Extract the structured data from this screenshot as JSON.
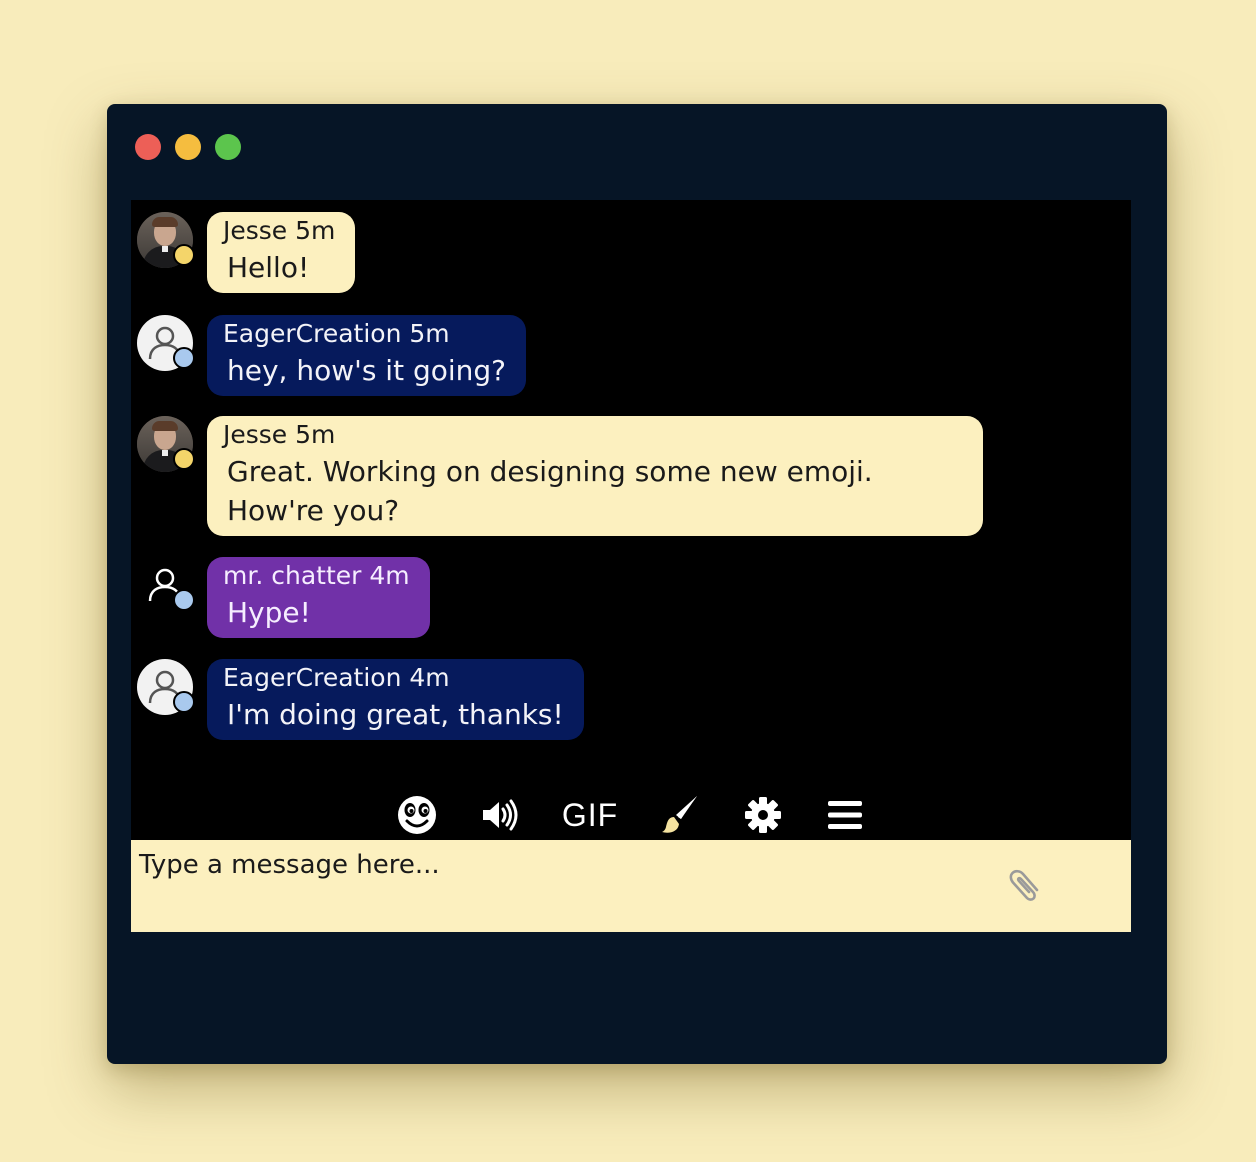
{
  "window": {
    "controls": [
      "close",
      "minimize",
      "maximize"
    ]
  },
  "messages": [
    {
      "author": "Jesse",
      "time": "5m",
      "meta": "Jesse 5m",
      "lines": [
        "Hello!"
      ],
      "style": "cream",
      "avatar": "photo",
      "presence": "away"
    },
    {
      "author": "EagerCreation",
      "time": "5m",
      "meta": "EagerCreation 5m",
      "lines": [
        "hey, how's it going?"
      ],
      "style": "navy",
      "avatar": "user-light",
      "presence": "online"
    },
    {
      "author": "Jesse",
      "time": "5m",
      "meta": "Jesse 5m",
      "lines": [
        "Great. Working on designing some new emoji.",
        "How're you?"
      ],
      "style": "cream",
      "avatar": "photo",
      "presence": "away"
    },
    {
      "author": "mr. chatter",
      "time": "4m",
      "meta": "mr. chatter 4m",
      "lines": [
        "Hype!"
      ],
      "style": "purple",
      "avatar": "user-dark",
      "presence": "online"
    },
    {
      "author": "EagerCreation",
      "time": "4m",
      "meta": "EagerCreation 4m",
      "lines": [
        "I'm doing great, thanks!"
      ],
      "style": "navy",
      "avatar": "user-light",
      "presence": "online"
    }
  ],
  "toolbar": {
    "emoji_icon": "emoji-face-icon",
    "sound_icon": "speaker-icon",
    "gif_label": "GIF",
    "paint_icon": "paintbrush-icon",
    "settings_icon": "gear-icon",
    "menu_icon": "hamburger-menu-icon"
  },
  "composer": {
    "placeholder": "Type a message here...",
    "attach_icon": "paperclip-icon"
  },
  "colors": {
    "page_bg": "#f8ecbb",
    "window_bg": "#061526",
    "chat_bg": "#000000",
    "cream_bubble": "#fcf0bf",
    "navy_bubble": "#061a5c",
    "purple_bubble": "#7131a8",
    "status_away": "#f4d56a",
    "status_online": "#a9c9ee"
  }
}
